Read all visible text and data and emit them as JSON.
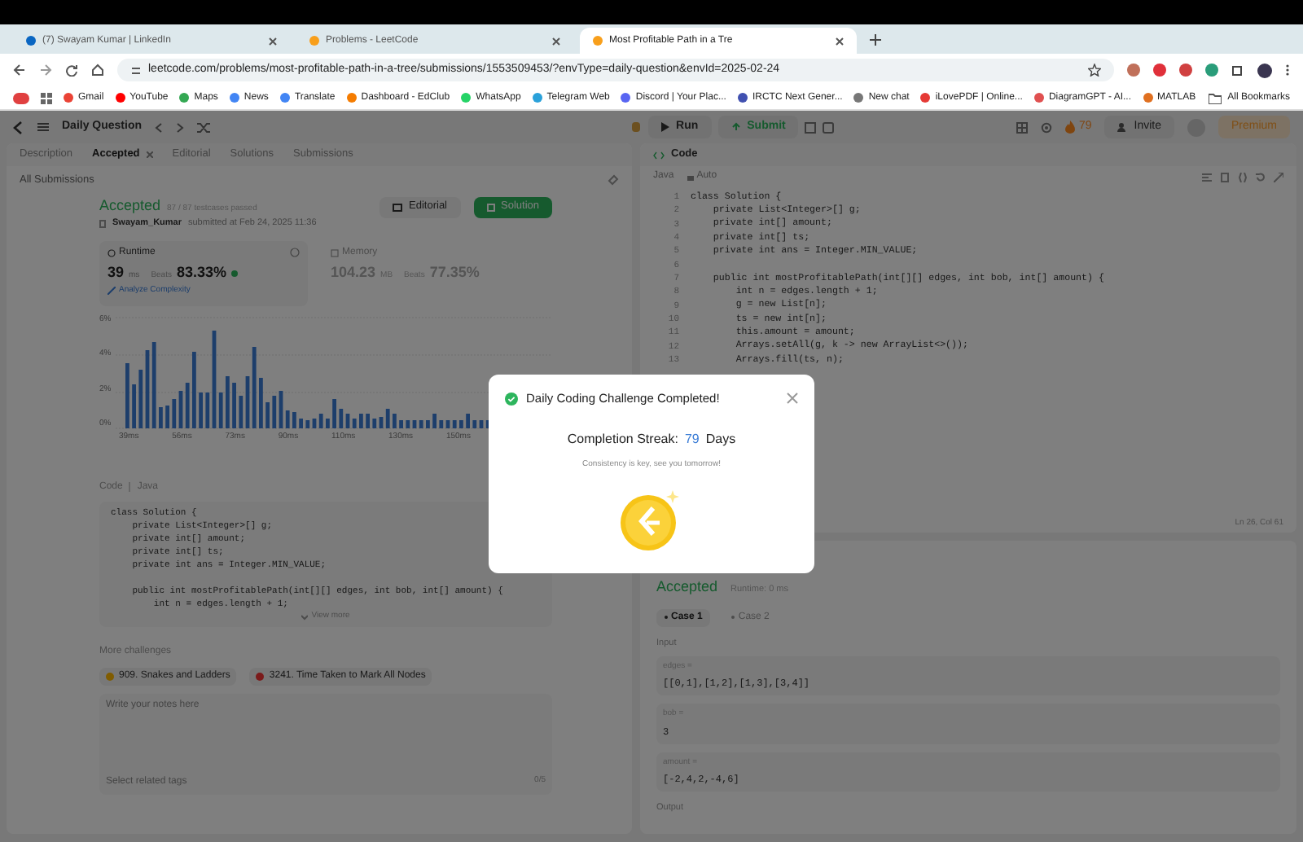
{
  "browser": {
    "tabs": [
      {
        "title": "(7) Swayam Kumar | LinkedIn",
        "selected": false
      },
      {
        "title": "Problems - LeetCode",
        "selected": false
      },
      {
        "title": "Most Profitable Path in a Tre",
        "selected": true
      }
    ],
    "url": "leetcode.com/problems/most-profitable-path-in-a-tree/submissions/1553509453/?envType=daily-question&envId=2025-02-24",
    "bookmarks": [
      "Gmail",
      "YouTube",
      "Maps",
      "News",
      "Translate",
      "Dashboard - EdClub",
      "WhatsApp",
      "Telegram Web",
      "Discord | Your Plac...",
      "IRCTC Next Gener...",
      "New chat",
      "iLovePDF | Online...",
      "DiagramGPT - AI...",
      "MATLAB"
    ],
    "all_bookmarks": "All Bookmarks"
  },
  "header": {
    "title": "Daily Question",
    "run": "Run",
    "submit": "Submit",
    "streak": "79",
    "invite": "Invite",
    "premium": "Premium"
  },
  "left_tabs": [
    {
      "label": "Description",
      "selected": false,
      "closable": false
    },
    {
      "label": "Accepted",
      "selected": true,
      "closable": true
    },
    {
      "label": "Editorial",
      "selected": false,
      "closable": false
    },
    {
      "label": "Solutions",
      "selected": false,
      "closable": false
    },
    {
      "label": "Submissions",
      "selected": false,
      "closable": false
    }
  ],
  "back_link": "All Submissions",
  "submission": {
    "status": "Accepted",
    "tests": "87 / 87 testcases passed",
    "user": "Swayam_Kumar",
    "submitted": "submitted at Feb 24, 2025 11:36",
    "editorial": "Editorial",
    "solution": "Solution"
  },
  "runtime": {
    "label": "Runtime",
    "value": "39",
    "unit": "ms",
    "beats": "Beats",
    "percent": "83.33%",
    "analyze": "Analyze Complexity"
  },
  "memory": {
    "label": "Memory",
    "value": "104.23",
    "unit": "MB",
    "beats": "Beats",
    "percent": "77.35%"
  },
  "chart": {
    "y_labels": [
      "6%",
      "4%",
      "2%",
      "0%"
    ],
    "x_labels": [
      "39ms",
      "56ms",
      "73ms",
      "90ms",
      "110ms",
      "130ms",
      "150ms"
    ]
  },
  "code_section": {
    "label": "Code",
    "language": "Java",
    "code": "class Solution {\n    private List<Integer>[] g;\n    private int[] amount;\n    private int[] ts;\n    private int ans = Integer.MIN_VALUE;\n\n    public int mostProfitablePath(int[][] edges, int bob, int[] amount) {\n        int n = edges.length + 1;",
    "view_more": "View more"
  },
  "more_challenges": {
    "title": "More challenges",
    "items": [
      {
        "label": "909. Snakes and Ladders",
        "color": "#805c00"
      },
      {
        "label": "3241. Time Taken to Mark All Nodes",
        "color": "#7b1b1b"
      }
    ]
  },
  "notes": {
    "placeholder": "Write your notes here",
    "tags_placeholder": "Select related tags",
    "count": "0/5"
  },
  "editor": {
    "tab": "Code",
    "language": "Java",
    "auto": "Auto",
    "cursor": "Ln 26, Col 61",
    "lines": [
      {
        "number": "1",
        "code": "class Solution {"
      },
      {
        "number": "2",
        "code": "    private List<Integer>[] g;"
      },
      {
        "number": "3",
        "code": "    private int[] amount;"
      },
      {
        "number": "4",
        "code": "    private int[] ts;"
      },
      {
        "number": "5",
        "code": "    private int ans = Integer.MIN_VALUE;"
      },
      {
        "number": "6"
      },
      {
        "number": "7",
        "code": "    public int mostProfitablePath(int[][] edges, int bob, int[] amount) {"
      },
      {
        "number": "8",
        "code": "        int n = edges.length + 1;"
      },
      {
        "number": "9",
        "code": "        g = new List[n];"
      },
      {
        "number": "10",
        "code": "        ts = new int[n];"
      },
      {
        "number": "11",
        "code": "        this.amount = amount;"
      },
      {
        "number": "12",
        "code": "        Arrays.setAll(g, k -> new ArrayList<>());"
      },
      {
        "number": "13",
        "code": "        Arrays.fill(ts, n);"
      }
    ]
  },
  "result": {
    "status": "Accepted",
    "runtime": "Runtime: 0 ms",
    "cases": [
      {
        "label": "Case 1",
        "selected": true
      },
      {
        "label": "Case 2",
        "selected": false
      }
    ],
    "input_label": "Input",
    "inputs": [
      {
        "name": "edges =",
        "value": "[[0,1],[1,2],[1,3],[3,4]]"
      },
      {
        "name": "bob =",
        "value": "3"
      },
      {
        "name": "amount =",
        "value": "[-2,4,2,-4,6]"
      }
    ],
    "output_label": "Output"
  },
  "modal": {
    "title": "Daily Coding Challenge Completed!",
    "streak_label": "Completion Streak:",
    "streak_value": "79",
    "streak_unit": "Days",
    "message": "Consistency is key, see you tomorrow!"
  }
}
